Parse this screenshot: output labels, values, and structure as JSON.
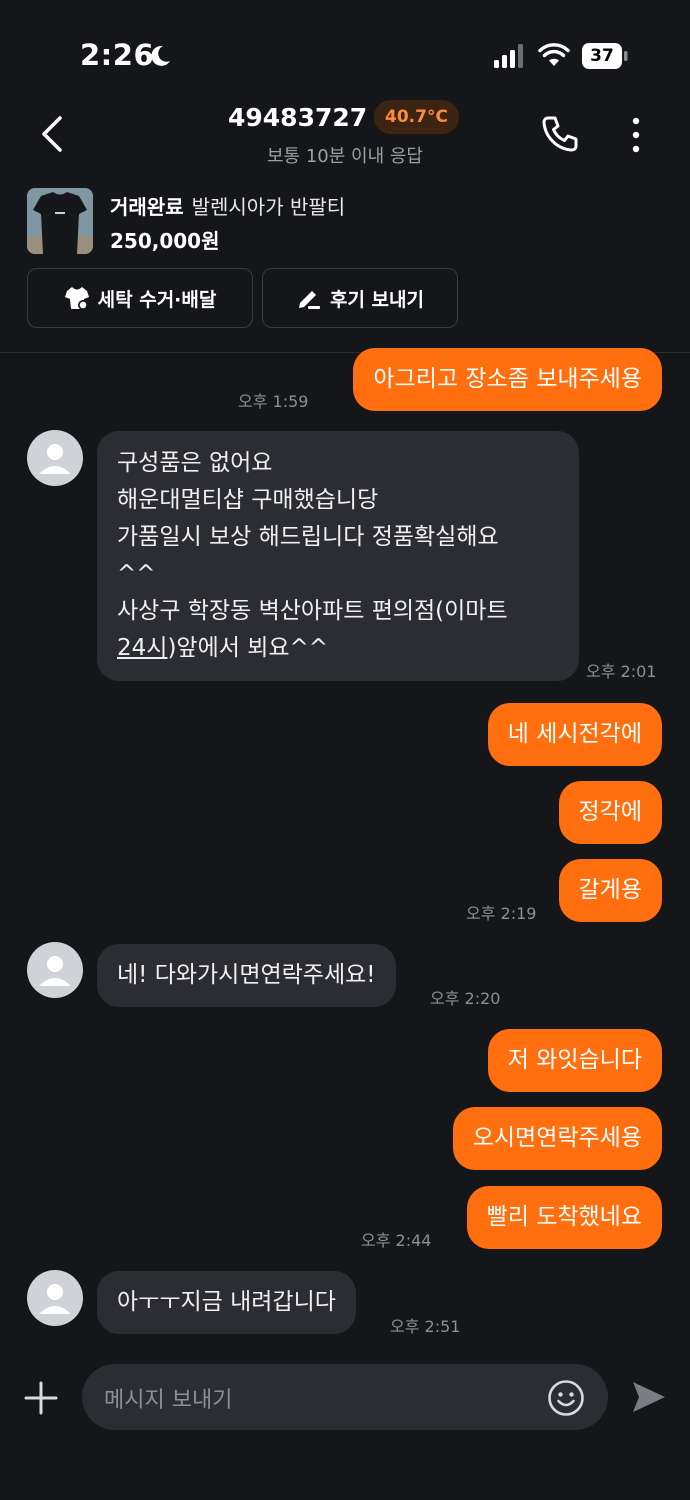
{
  "status_bar": {
    "time": "2:26",
    "battery": "37"
  },
  "header": {
    "title": "49483727",
    "temperature": "40.7°C",
    "subtitle": "보통 10분 이내 응답"
  },
  "product": {
    "status": "거래완료",
    "name": "발렌시아가 반팔티",
    "price": "250,000원",
    "buttons": {
      "laundry": "세탁 수거·배달",
      "review": "후기 보내기"
    }
  },
  "messages": [
    {
      "from": "me",
      "text": "아그리고 장소좀 보내주세용",
      "time": "오후 1:59"
    },
    {
      "from": "them",
      "lines": [
        "구성품은 없어요",
        "해운대멀티샵 구매했습니당",
        "가품일시 보상 해드립니다 정품확실해요",
        "^^",
        "사상구 학장동 벽산아파트 편의점(이마트"
      ],
      "last_link": "24시",
      "last_rest": ")앞에서 뵈요^^",
      "time": "오후 2:01"
    },
    {
      "from": "me",
      "text": "네 세시전각에"
    },
    {
      "from": "me",
      "text": "정각에"
    },
    {
      "from": "me",
      "text": "갈게용",
      "time": "오후 2:19"
    },
    {
      "from": "them",
      "text": "네! 다와가시면연락주세요!",
      "time": "오후 2:20"
    },
    {
      "from": "me",
      "text": "저 와잇습니다"
    },
    {
      "from": "me",
      "text": "오시면연락주세용"
    },
    {
      "from": "me",
      "text": "빨리 도착했네요",
      "time": "오후 2:44"
    },
    {
      "from": "them",
      "text": "아ㅜㅜ지금 내려갑니다",
      "time": "오후 2:51"
    }
  ],
  "composer": {
    "placeholder": "메시지 보내기"
  },
  "colors": {
    "accent": "#ff6f0f",
    "background": "#151619",
    "incoming_bubble": "#2b2d32"
  }
}
